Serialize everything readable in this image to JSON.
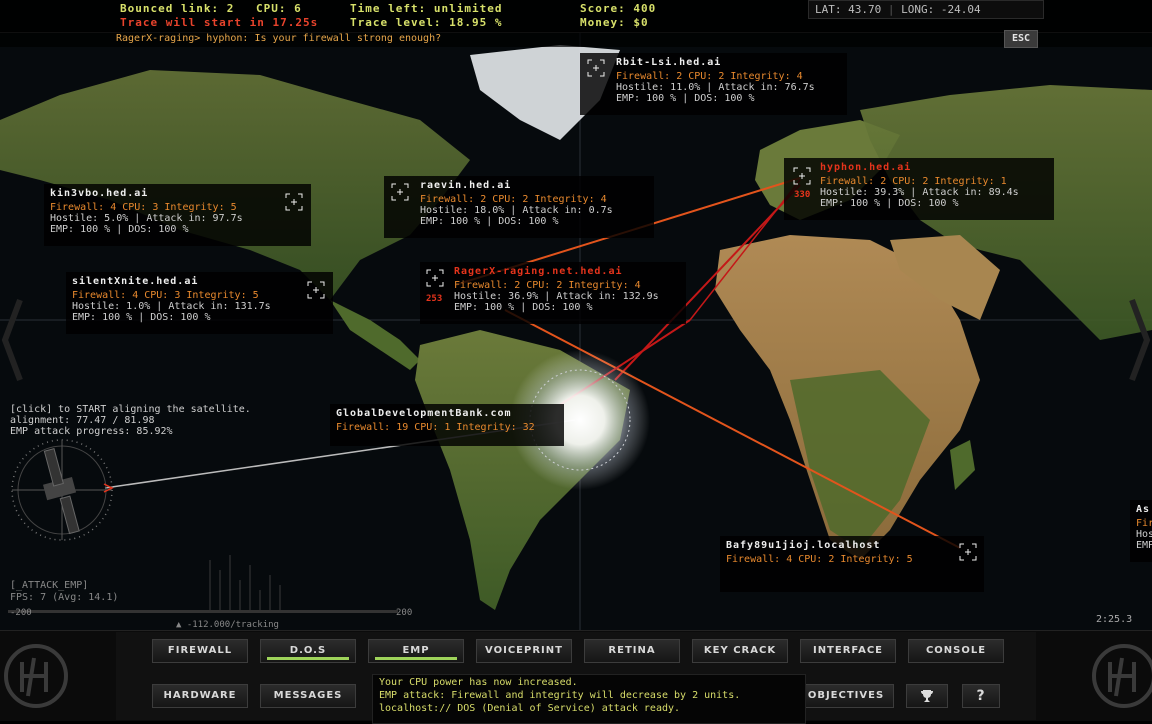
{
  "top": {
    "bounced_link": "Bounced link: 2",
    "cpu": "CPU: 6",
    "trace_warning": "Trace will start in 17.25s",
    "time_left": "Time left: unlimited",
    "trace_level": "Trace level: 18.95 %",
    "score": "Score: 400",
    "money": "Money: $0",
    "lat": "LAT: 43.70",
    "long": "LONG: -24.04",
    "esc_label": "ESC"
  },
  "chat": "RagerX-raging> hyphon: Is your firewall strong enough?",
  "nodes": [
    {
      "name": "Rbit-Lsi.hed.ai",
      "line1": "Firewall: 2 CPU: 2 Integrity: 4",
      "line2": "Hostile: 11.0% | Attack in: 76.7s",
      "line3": "EMP: 100 % | DOS: 100 %"
    },
    {
      "name": "kin3vbo.hed.ai",
      "line1": "Firewall: 4 CPU: 3 Integrity: 5",
      "line2": "Hostile: 5.0% | Attack in: 97.7s",
      "line3": "EMP: 100 % | DOS: 100 %"
    },
    {
      "name": "raevin.hed.ai",
      "line1": "Firewall: 2 CPU: 2 Integrity: 4",
      "line2": "Hostile: 18.0% | Attack in: 0.7s",
      "line3": "EMP: 100 % | DOS: 100 %"
    },
    {
      "name": "hyphon.hed.ai",
      "threat": "330",
      "line1": "Firewall: 2 CPU: 2 Integrity: 1",
      "line2": "Hostile: 39.3% | Attack in: 89.4s",
      "line3": "EMP: 100 % | DOS: 100 %"
    },
    {
      "name": "silentXnite.hed.ai",
      "line1": "Firewall: 4 CPU: 3 Integrity: 5",
      "line2": "Hostile: 1.0% | Attack in: 131.7s",
      "line3": "EMP: 100 % | DOS: 100 %"
    },
    {
      "name": "RagerX-raging.net.hed.ai",
      "threat": "253",
      "line1": "Firewall: 2 CPU: 2 Integrity: 4",
      "line2": "Hostile: 36.9% | Attack in: 132.9s",
      "line3": "EMP: 100 % | DOS: 100 %"
    },
    {
      "name": "GlobalDevelopmentBank.com",
      "line1": "Firewall: 19 CPU: 1 Integrity: 32"
    },
    {
      "name": "Bafy89u1jioj.localhost",
      "line1": "Firewall: 4 CPU: 2 Integrity: 5"
    },
    {
      "name": "As",
      "line1": "Fir",
      "line2": "Hos",
      "line3": "EMP"
    }
  ],
  "satellite": {
    "hint": "[click] to START aligning the satellite.",
    "alignment": "alignment: 77.47 / 81.98",
    "emp_progress": "EMP attack progress: 85.92%"
  },
  "debug": {
    "attack": "[_ATTACK_EMP]",
    "fps": "FPS:   7 (Avg: 14.1)",
    "axis_min": "-200",
    "axis_max": "200",
    "tracking": "-112.000/tracking"
  },
  "clock": "2:25.3",
  "toolbar_row1": [
    {
      "label": "FIREWALL",
      "active": false
    },
    {
      "label": "D.O.S",
      "active": true
    },
    {
      "label": "EMP",
      "active": true
    },
    {
      "label": "VOICEPRINT",
      "active": false
    },
    {
      "label": "RETINA",
      "active": false
    },
    {
      "label": "KEY CRACK",
      "active": false
    },
    {
      "label": "INTERFACE",
      "active": false
    },
    {
      "label": "CONSOLE",
      "active": false
    }
  ],
  "toolbar_row2": [
    {
      "label": "HARDWARE"
    },
    {
      "label": "MESSAGES"
    }
  ],
  "objectives_label": "OBJECTIVES",
  "trophy_icon": "trophy-icon",
  "help_label": "?",
  "log": [
    "Your CPU power has now increased.",
    "EMP attack: Firewall and integrity will decrease by 2 units.",
    "localhost:// DOS (Denial of Service) attack ready."
  ],
  "colors": {
    "accent_yellow": "#d7e06a",
    "warning_red": "#e8432c",
    "node_orange": "#e8892e",
    "active_green": "#9ed35a"
  }
}
